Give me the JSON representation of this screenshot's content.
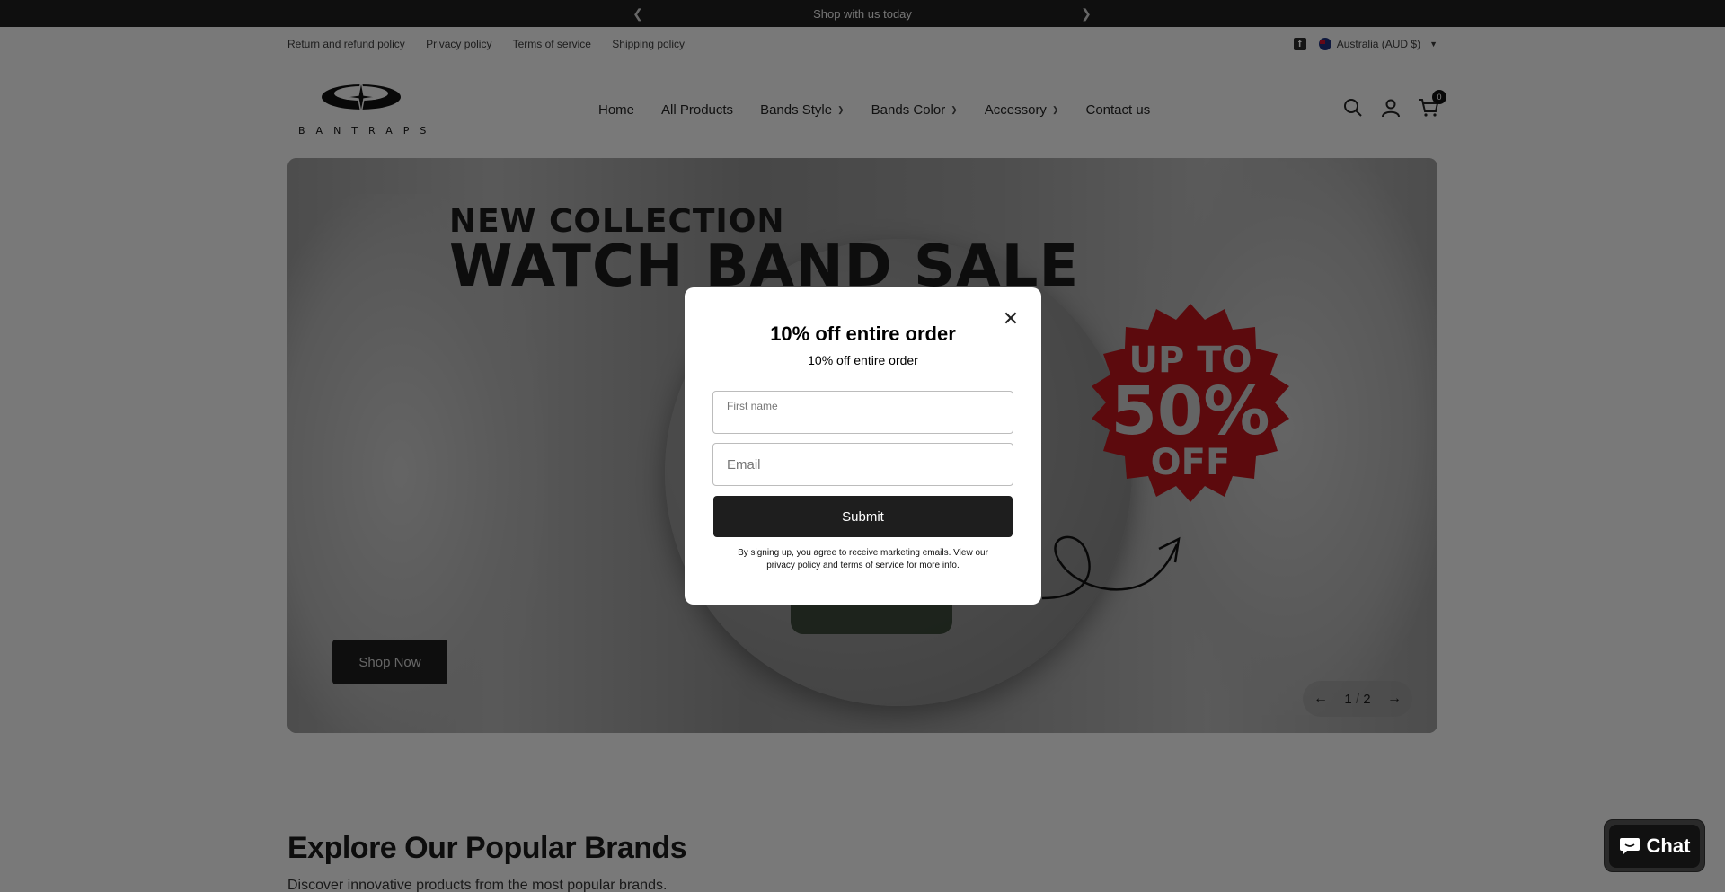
{
  "announcement": {
    "text": "Shop with us today",
    "prev_icon": "chevron-left-icon",
    "next_icon": "chevron-right-icon"
  },
  "utility": {
    "links": [
      "Return and refund policy",
      "Privacy policy",
      "Terms of service",
      "Shipping policy"
    ],
    "region": "Australia (AUD $)",
    "social_icon": "facebook-icon"
  },
  "header": {
    "logo_text": "BANTRAPS",
    "nav": [
      {
        "label": "Home",
        "dropdown": false
      },
      {
        "label": "All Products",
        "dropdown": false
      },
      {
        "label": "Bands Style",
        "dropdown": true
      },
      {
        "label": "Bands Color",
        "dropdown": true
      },
      {
        "label": "Accessory",
        "dropdown": true
      },
      {
        "label": "Contact us",
        "dropdown": false
      }
    ],
    "cart_count": "0"
  },
  "hero": {
    "line1": "NEW COLLECTION",
    "line2": "WATCH BAND SALE",
    "badge": {
      "l1": "UP TO",
      "l2": "50%",
      "l3": "OFF"
    },
    "cta": "Shop Now",
    "slide_current": "1",
    "slide_sep": "/",
    "slide_total": "2"
  },
  "section": {
    "title": "Explore Our Popular Brands",
    "subtitle": "Discover innovative products from the most popular brands."
  },
  "modal": {
    "title": "10% off entire order",
    "subtitle": "10% off entire order",
    "first_name_label": "First name",
    "email_placeholder": "Email",
    "submit": "Submit",
    "legal": "By signing up, you agree to receive marketing emails. View our privacy policy and terms of service for more info."
  },
  "chat": {
    "label": "Chat"
  },
  "colors": {
    "overlay": "#000000",
    "button_dark": "#1e1e1e",
    "badge_red": "#b8141a"
  }
}
